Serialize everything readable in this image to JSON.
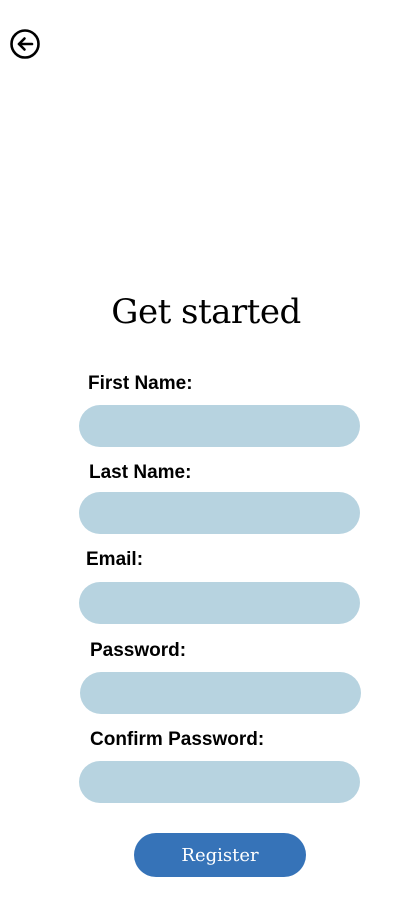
{
  "header": {
    "back_icon": "arrow-left-circle-icon"
  },
  "title": "Get started",
  "form": {
    "first_name_label": "First Name:",
    "first_name_value": "",
    "last_name_label": "Last Name:",
    "last_name_value": "",
    "email_label": "Email:",
    "email_value": "",
    "password_label": "Password:",
    "password_value": "",
    "confirm_password_label": "Confirm Password:",
    "confirm_password_value": ""
  },
  "register_button": {
    "label": "Register"
  },
  "colors": {
    "input_background": "#b7d3e0",
    "button_background": "#3673b8",
    "button_text": "#ffffff"
  }
}
